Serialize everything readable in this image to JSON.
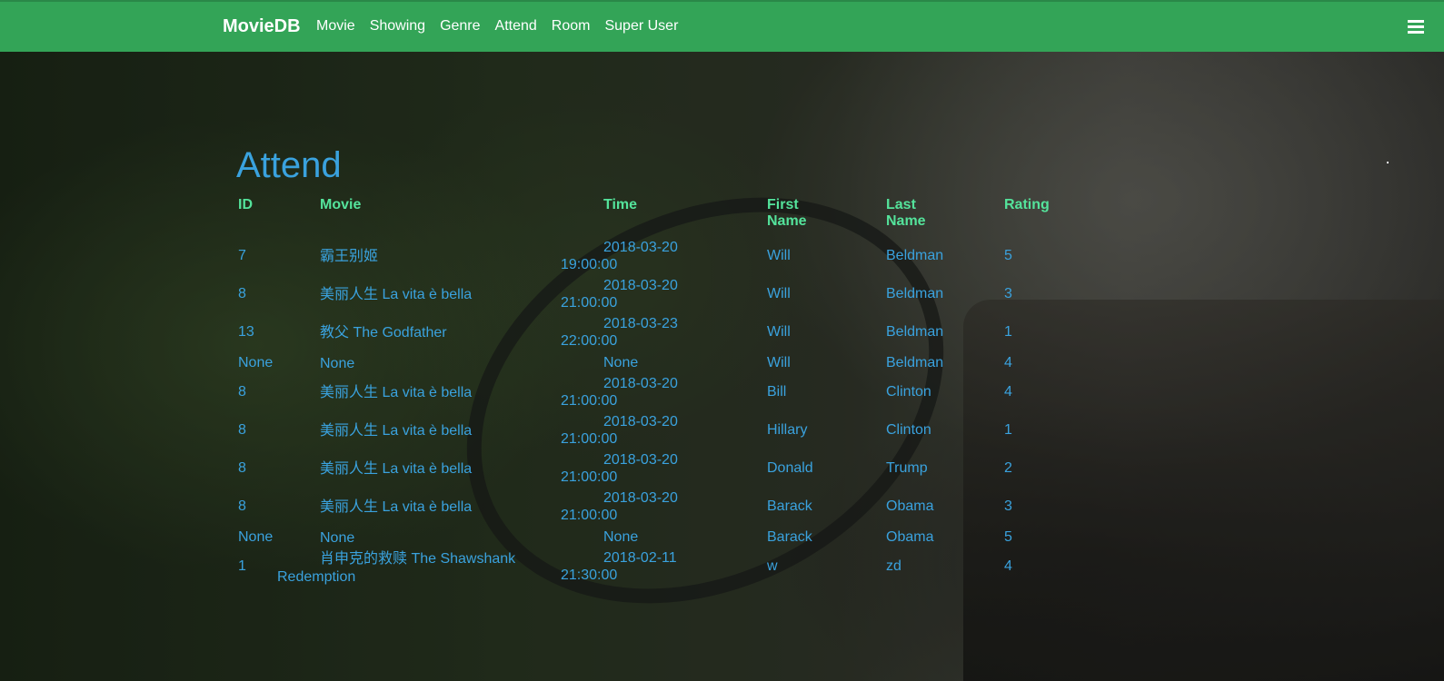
{
  "navbar": {
    "brand": "MovieDB",
    "links": [
      "Movie",
      "Showing",
      "Genre",
      "Attend",
      "Room",
      "Super User"
    ],
    "menu_icon": "hamburger-icon"
  },
  "page": {
    "title": "Attend"
  },
  "table": {
    "headers": [
      "ID",
      "Movie",
      "Time",
      "First Name",
      "Last Name",
      "Rating"
    ],
    "rows": [
      {
        "id": "7",
        "movie": "霸王别姬",
        "time_date": "2018-03-20",
        "time_clock": "19:00:00",
        "first": "Will",
        "last": "Beldman",
        "rating": "5"
      },
      {
        "id": "8",
        "movie": "美丽人生 La vita è bella",
        "time_date": "2018-03-20",
        "time_clock": "21:00:00",
        "first": "Will",
        "last": "Beldman",
        "rating": "3"
      },
      {
        "id": "13",
        "movie": "教父 The Godfather",
        "time_date": "2018-03-23",
        "time_clock": "22:00:00",
        "first": "Will",
        "last": "Beldman",
        "rating": "1"
      },
      {
        "id": "None",
        "movie": "None",
        "time_date": "None",
        "time_clock": "",
        "first": "Will",
        "last": "Beldman",
        "rating": "4"
      },
      {
        "id": "8",
        "movie": "美丽人生 La vita è bella",
        "time_date": "2018-03-20",
        "time_clock": "21:00:00",
        "first": "Bill",
        "last": "Clinton",
        "rating": "4"
      },
      {
        "id": "8",
        "movie": "美丽人生 La vita è bella",
        "time_date": "2018-03-20",
        "time_clock": "21:00:00",
        "first": "Hillary",
        "last": "Clinton",
        "rating": "1"
      },
      {
        "id": "8",
        "movie": "美丽人生 La vita è bella",
        "time_date": "2018-03-20",
        "time_clock": "21:00:00",
        "first": "Donald",
        "last": "Trump",
        "rating": "2"
      },
      {
        "id": "8",
        "movie": "美丽人生 La vita è bella",
        "time_date": "2018-03-20",
        "time_clock": "21:00:00",
        "first": "Barack",
        "last": "Obama",
        "rating": "3"
      },
      {
        "id": "None",
        "movie": "None",
        "time_date": "None",
        "time_clock": "",
        "first": "Barack",
        "last": "Obama",
        "rating": "5"
      },
      {
        "id": "1",
        "movie": "肖申克的救赎 The Shawshank",
        "movie_line2": "Redemption",
        "time_date": "2018-02-11",
        "time_clock": "21:30:00",
        "first": "w",
        "last": "zd",
        "rating": "4"
      }
    ]
  },
  "colors": {
    "navbar": "#33a457",
    "header_text": "#54e39b",
    "cell_text": "#3aa2de",
    "title_text": "#3aa2de"
  }
}
